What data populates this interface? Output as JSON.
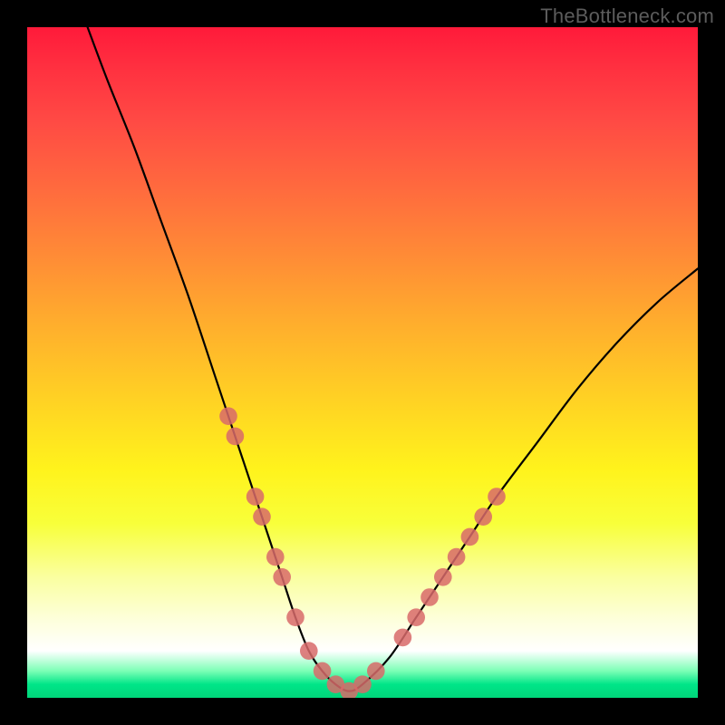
{
  "watermark": "TheBottleneck.com",
  "chart_data": {
    "type": "line",
    "title": "",
    "xlabel": "",
    "ylabel": "",
    "xlim": [
      0,
      100
    ],
    "ylim": [
      0,
      100
    ],
    "series": [
      {
        "name": "bottleneck-curve",
        "x": [
          9,
          12,
          16,
          20,
          24,
          28,
          30,
          32,
          34,
          36,
          38,
          40,
          42,
          44,
          46,
          48,
          50,
          54,
          58,
          62,
          66,
          70,
          76,
          82,
          88,
          94,
          100
        ],
        "values": [
          100,
          92,
          82,
          71,
          60,
          48,
          42,
          36,
          30,
          24,
          18,
          12,
          7,
          4,
          2,
          1,
          2,
          6,
          12,
          18,
          24,
          30,
          38,
          46,
          53,
          59,
          64
        ]
      }
    ],
    "markers": {
      "name": "highlighted-points",
      "color": "#d86a6a",
      "points": [
        {
          "x": 30,
          "y": 42,
          "r": 1.3
        },
        {
          "x": 31,
          "y": 39,
          "r": 1.3
        },
        {
          "x": 34,
          "y": 30,
          "r": 1.3
        },
        {
          "x": 35,
          "y": 27,
          "r": 1.3
        },
        {
          "x": 37,
          "y": 21,
          "r": 1.3
        },
        {
          "x": 38,
          "y": 18,
          "r": 1.3
        },
        {
          "x": 40,
          "y": 12,
          "r": 1.3
        },
        {
          "x": 42,
          "y": 7,
          "r": 1.3
        },
        {
          "x": 44,
          "y": 4,
          "r": 1.3
        },
        {
          "x": 46,
          "y": 2,
          "r": 1.3
        },
        {
          "x": 48,
          "y": 1,
          "r": 1.3
        },
        {
          "x": 50,
          "y": 2,
          "r": 1.3
        },
        {
          "x": 52,
          "y": 4,
          "r": 1.3
        },
        {
          "x": 56,
          "y": 9,
          "r": 1.3
        },
        {
          "x": 58,
          "y": 12,
          "r": 1.3
        },
        {
          "x": 60,
          "y": 15,
          "r": 1.3
        },
        {
          "x": 62,
          "y": 18,
          "r": 1.3
        },
        {
          "x": 64,
          "y": 21,
          "r": 1.3
        },
        {
          "x": 66,
          "y": 24,
          "r": 1.3
        },
        {
          "x": 68,
          "y": 27,
          "r": 1.3
        },
        {
          "x": 70,
          "y": 30,
          "r": 1.3
        }
      ]
    }
  }
}
